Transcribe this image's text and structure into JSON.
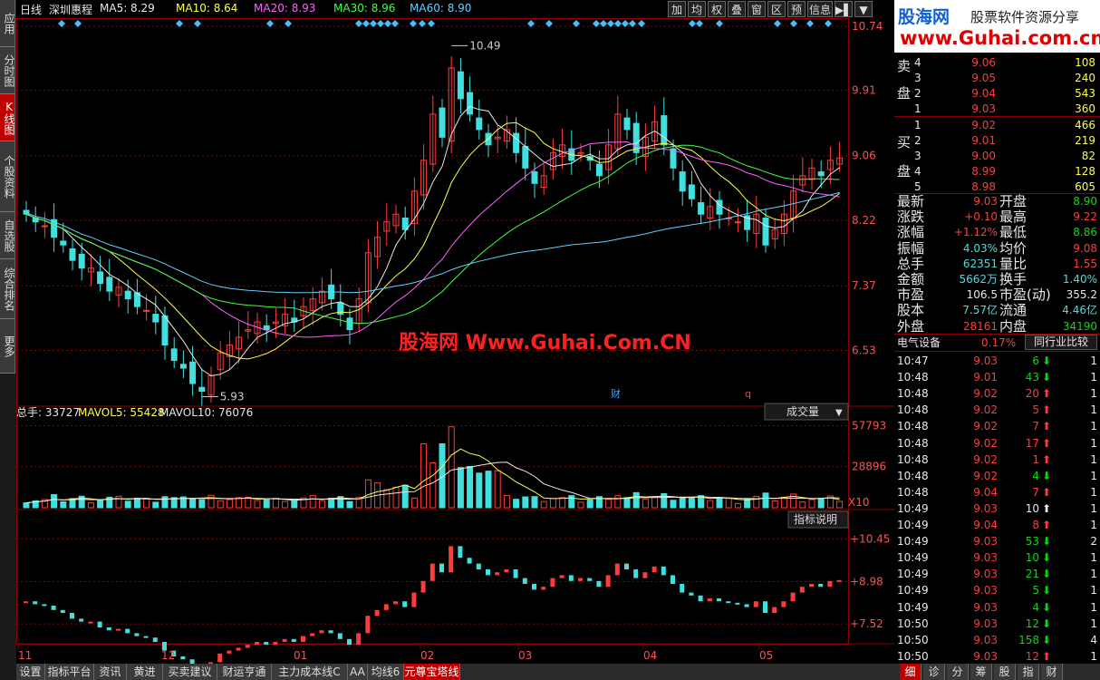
{
  "left_tabs": [
    {
      "label": "应用",
      "active": false
    },
    {
      "label": "分时图",
      "active": false
    },
    {
      "label": "K线图",
      "active": true
    },
    {
      "label": "个股资料",
      "active": false
    },
    {
      "label": "自选股",
      "active": false
    },
    {
      "label": "综合排名",
      "active": false
    },
    {
      "label": "更多",
      "active": false
    }
  ],
  "header": {
    "period": "日线",
    "stock_name": "深圳惠程",
    "ma": [
      {
        "label": "MA5: 8.29",
        "color": "#e8e8e8"
      },
      {
        "label": "MA10: 8.64",
        "color": "#ffff40"
      },
      {
        "label": "MA20: 8.93",
        "color": "#ff60ff"
      },
      {
        "label": "MA30: 8.96",
        "color": "#40ff40"
      },
      {
        "label": "MA60: 8.90",
        "color": "#60d0ff"
      }
    ],
    "toolbar": [
      "加",
      "均",
      "权",
      "叠",
      "窗",
      "区",
      "预",
      "信息",
      "▶▌",
      "▼"
    ]
  },
  "watermark": {
    "logo_text": "股海网",
    "logo_slogan": "股票软件资源分享",
    "logo_url": "www.Guhai.com.cn",
    "center_text": "股海网 Www.Guhai.Com.CN"
  },
  "kline": {
    "price_axis": [
      "10.74",
      "9.91",
      "9.06",
      "8.22",
      "7.37",
      "6.53"
    ],
    "high_label": "10.49",
    "low_label": "5.93",
    "event_marks": [
      "财",
      "q"
    ]
  },
  "volume": {
    "legend": [
      {
        "label": "总手: 33727",
        "color": "#e8e8e8"
      },
      {
        "label": "MAVOL5: 55428",
        "color": "#ffff40"
      },
      {
        "label": "MAVOL10: 76076",
        "color": "#e8e8e8"
      }
    ],
    "selector": "成交量",
    "axis": [
      "57793",
      "28896",
      "X10"
    ]
  },
  "indicator": {
    "button": "指标说明",
    "axis": [
      "+10.45",
      "+8.98",
      "+7.52"
    ]
  },
  "time_axis": [
    "11",
    "12",
    "01",
    "02",
    "03",
    "04",
    "05"
  ],
  "bottom_tabs": [
    {
      "label": "设置",
      "active": false
    },
    {
      "label": "指标平台",
      "active": false
    },
    {
      "label": "资讯",
      "active": false
    },
    {
      "label": "黄进",
      "active": false
    },
    {
      "label": "买卖建议",
      "active": false
    },
    {
      "label": "财运亨通",
      "active": false
    },
    {
      "label": "主力成本线C",
      "active": false
    },
    {
      "label": "AA",
      "active": false
    },
    {
      "label": "均线6",
      "active": false
    },
    {
      "label": "元尊宝塔线",
      "active": true
    }
  ],
  "right_tabs": [
    "细",
    "诊",
    "分",
    "筹",
    "股",
    "指",
    "财"
  ],
  "quote": {
    "sell": [
      {
        "n": "4",
        "price": "9.06",
        "vol": "108"
      },
      {
        "n": "3",
        "price": "9.05",
        "vol": "240"
      },
      {
        "n": "2",
        "price": "9.04",
        "vol": "543"
      },
      {
        "n": "1",
        "price": "9.03",
        "vol": "360"
      }
    ],
    "sell_label": [
      "卖",
      "盘"
    ],
    "buy": [
      {
        "n": "1",
        "price": "9.02",
        "vol": "466"
      },
      {
        "n": "2",
        "price": "9.01",
        "vol": "219"
      },
      {
        "n": "3",
        "price": "9.00",
        "vol": "82"
      },
      {
        "n": "4",
        "price": "8.99",
        "vol": "128"
      },
      {
        "n": "5",
        "price": "8.98",
        "vol": "605"
      }
    ],
    "buy_label": [
      "买",
      "盘"
    ],
    "stats": [
      {
        "k1": "最新",
        "v1": "9.03",
        "c1": "red",
        "k2": "开盘",
        "v2": "8.90",
        "c2": "grn"
      },
      {
        "k1": "涨跌",
        "v1": "+0.10",
        "c1": "red",
        "k2": "最高",
        "v2": "9.22",
        "c2": "red"
      },
      {
        "k1": "涨幅",
        "v1": "+1.12%",
        "c1": "red",
        "k2": "最低",
        "v2": "8.86",
        "c2": "grn"
      },
      {
        "k1": "振幅",
        "v1": "4.03%",
        "c1": "cyan",
        "k2": "均价",
        "v2": "9.08",
        "c2": "red"
      },
      {
        "k1": "总手",
        "v1": "62351",
        "c1": "cyan",
        "k2": "量比",
        "v2": "1.55",
        "c2": "red"
      },
      {
        "k1": "金额",
        "v1": "5662万",
        "c1": "cyan",
        "k2": "换手",
        "v2": "1.40%",
        "c2": "cyan"
      },
      {
        "k1": "市盈",
        "v1": "106.5",
        "c1": "wht",
        "k2": "市盈(动)",
        "v2": "355.2",
        "c2": "wht"
      },
      {
        "k1": "股本",
        "v1": "7.57亿",
        "c1": "cyan",
        "k2": "流通",
        "v2": "4.46亿",
        "c2": "cyan"
      },
      {
        "k1": "外盘",
        "v1": "28161",
        "c1": "red",
        "k2": "内盘",
        "v2": "34190",
        "c2": "grn"
      }
    ],
    "industry": "电气设备",
    "industry_pct": "0.17%",
    "compare_button": "同行业比较"
  },
  "ticks": [
    {
      "t": "10:47",
      "p": "9.03",
      "v": "6",
      "d": "down",
      "x": "1"
    },
    {
      "t": "10:48",
      "p": "9.01",
      "v": "43",
      "d": "down",
      "x": "1"
    },
    {
      "t": "10:48",
      "p": "9.02",
      "v": "20",
      "d": "up",
      "x": "1"
    },
    {
      "t": "10:48",
      "p": "9.02",
      "v": "5",
      "d": "up",
      "x": "1"
    },
    {
      "t": "10:48",
      "p": "9.02",
      "v": "7",
      "d": "up",
      "x": "1"
    },
    {
      "t": "10:48",
      "p": "9.02",
      "v": "17",
      "d": "up",
      "x": "1"
    },
    {
      "t": "10:48",
      "p": "9.02",
      "v": "1",
      "d": "up",
      "x": "1"
    },
    {
      "t": "10:48",
      "p": "9.02",
      "v": "4",
      "d": "down",
      "x": "1"
    },
    {
      "t": "10:48",
      "p": "9.04",
      "v": "7",
      "d": "up",
      "x": "1"
    },
    {
      "t": "10:49",
      "p": "9.03",
      "v": "10",
      "d": "white",
      "x": "1"
    },
    {
      "t": "10:49",
      "p": "9.04",
      "v": "8",
      "d": "up",
      "x": "1"
    },
    {
      "t": "10:49",
      "p": "9.03",
      "v": "53",
      "d": "down",
      "x": "2"
    },
    {
      "t": "10:49",
      "p": "9.03",
      "v": "10",
      "d": "down",
      "x": "1"
    },
    {
      "t": "10:49",
      "p": "9.03",
      "v": "21",
      "d": "down",
      "x": "1"
    },
    {
      "t": "10:49",
      "p": "9.03",
      "v": "5",
      "d": "down",
      "x": "1"
    },
    {
      "t": "10:49",
      "p": "9.03",
      "v": "4",
      "d": "down",
      "x": "1"
    },
    {
      "t": "10:50",
      "p": "9.03",
      "v": "12",
      "d": "down",
      "x": "1"
    },
    {
      "t": "10:50",
      "p": "9.03",
      "v": "158",
      "d": "down",
      "x": "4"
    },
    {
      "t": "10:50",
      "p": "9.03",
      "v": "12",
      "d": "up",
      "x": "1"
    }
  ],
  "chart_data": {
    "type": "candlestick",
    "series": [
      {
        "name": "MA5",
        "color": "#e8e8e8"
      },
      {
        "name": "MA10",
        "color": "#ffff40"
      },
      {
        "name": "MA20",
        "color": "#ff60ff"
      },
      {
        "name": "MA30",
        "color": "#40ff40"
      },
      {
        "name": "MA60",
        "color": "#60d0ff"
      }
    ],
    "y_ticks": [
      10.74,
      9.91,
      9.06,
      8.22,
      7.37,
      6.53
    ],
    "ylim": [
      5.9,
      10.8
    ],
    "high": 10.49,
    "low": 5.93,
    "close": [
      8.3,
      8.2,
      8.15,
      8.0,
      7.9,
      7.7,
      7.6,
      7.6,
      7.4,
      7.3,
      7.35,
      7.2,
      7.1,
      7.05,
      6.9,
      6.6,
      6.4,
      6.3,
      6.1,
      6.0,
      6.2,
      6.5,
      6.6,
      6.7,
      6.8,
      6.9,
      6.8,
      6.9,
      7.0,
      6.9,
      7.1,
      7.2,
      7.3,
      7.2,
      7.0,
      6.8,
      7.2,
      7.8,
      8.0,
      8.2,
      8.3,
      8.1,
      8.6,
      9.0,
      9.6,
      9.3,
      10.2,
      9.8,
      9.6,
      9.4,
      9.2,
      9.3,
      9.4,
      9.1,
      8.9,
      8.7,
      8.8,
      9.1,
      9.2,
      9.0,
      9.1,
      9.0,
      8.8,
      9.2,
      9.6,
      9.4,
      9.1,
      9.3,
      9.5,
      9.2,
      8.9,
      8.6,
      8.5,
      8.3,
      8.4,
      8.3,
      8.25,
      8.2,
      8.1,
      8.3,
      7.9,
      8.1,
      8.3,
      8.6,
      8.8,
      8.9,
      8.8,
      9.0,
      9.03
    ],
    "volume_ylim": [
      0,
      60000
    ],
    "volume_ticks": [
      57793,
      28896
    ]
  }
}
